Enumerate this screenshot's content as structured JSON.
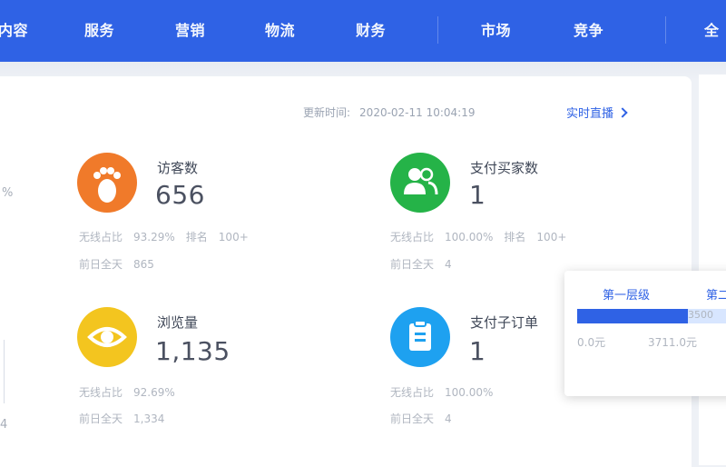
{
  "nav": {
    "items": [
      {
        "label": "内容"
      },
      {
        "label": "服务"
      },
      {
        "label": "营销"
      },
      {
        "label": "物流"
      },
      {
        "label": "财务"
      },
      {
        "label": "市场"
      },
      {
        "label": "竞争"
      },
      {
        "label": "全"
      }
    ]
  },
  "header": {
    "updated_label": "更新时间:",
    "updated_value": "2020-02-11 10:04:19",
    "realtime_link": "实时直播"
  },
  "left_edge": {
    "percent_text": "%",
    "bottom_text": "4"
  },
  "metrics": [
    {
      "title": "访客数",
      "value": "656",
      "icon": "footprint-icon",
      "color": "#f07a2a",
      "row1": [
        "无线占比",
        "93.29%",
        "排名",
        "100+"
      ],
      "row2": [
        "前日全天",
        "865"
      ]
    },
    {
      "title": "支付买家数",
      "value": "1",
      "icon": "users-icon",
      "color": "#25b348",
      "row1": [
        "无线占比",
        "100.00%",
        "排名",
        "100+"
      ],
      "row2": [
        "前日全天",
        "4"
      ]
    },
    {
      "title": "浏览量",
      "value": "1,135",
      "icon": "eye-icon",
      "color": "#f3c51f",
      "row1": [
        "无线占比",
        "92.69%"
      ],
      "row2": [
        "前日全天",
        "1,334"
      ]
    },
    {
      "title": "支付子订单",
      "value": "1",
      "icon": "clipboard-icon",
      "color": "#1ea1f0",
      "row1": [
        "无线占比",
        "100.00%"
      ],
      "row2": [
        "前日全天",
        "4"
      ]
    }
  ],
  "popup": {
    "tab1": "第一层级",
    "tab2": "第二",
    "bar_fill_fraction": 0.68,
    "bar_end_label": "3500",
    "left_label": "0.0元",
    "right_label": "3711.0元"
  }
}
